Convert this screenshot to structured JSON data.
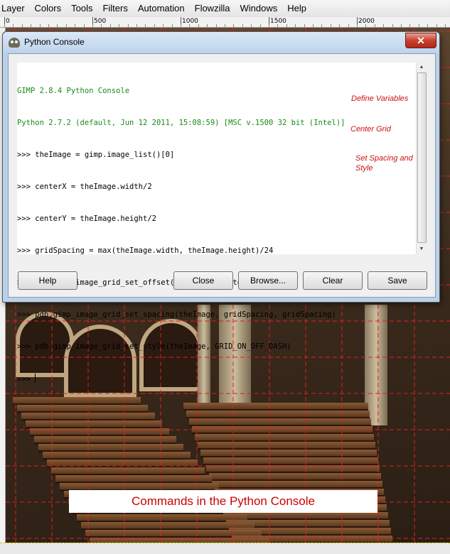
{
  "menubar": {
    "items": [
      {
        "label": "Layer"
      },
      {
        "label": "Colors"
      },
      {
        "label": "Tools"
      },
      {
        "label": "Filters"
      },
      {
        "label": "Automation"
      },
      {
        "label": "Flowzilla"
      },
      {
        "label": "Windows"
      },
      {
        "label": "Help"
      }
    ]
  },
  "ruler": {
    "labels": [
      "0",
      "500",
      "1000",
      "1500",
      "2000"
    ]
  },
  "dialog": {
    "title": "Python Console",
    "close_glyph": "✕",
    "console_lines": [
      {
        "text": "GIMP 2.8.4 Python Console",
        "color": "green"
      },
      {
        "text": "Python 2.7.2 (default, Jun 12 2011, 15:08:59) [MSC v.1500 32 bit (Intel)]",
        "color": "green"
      },
      {
        "text": ">>> theImage = gimp.image_list()[0]",
        "color": "black"
      },
      {
        "text": ">>> centerX = theImage.width/2",
        "color": "black"
      },
      {
        "text": ">>> centerY = theImage.height/2",
        "color": "black"
      },
      {
        "text": ">>> gridSpacing = max(theImage.width, theImage.height)/24",
        "color": "black"
      },
      {
        "text": ">>> pdb.gimp_image_grid_set_offset(theImage, centerX, centerY)",
        "color": "black"
      },
      {
        "text": ">>> pdb.gimp_image_grid_set_spacing(theImage, gridSpacing, gridSpacing)",
        "color": "black"
      },
      {
        "text": ">>> pdb.gimp_image_grid_set_style(theImage, GRID_ON_OFF_DASH)",
        "color": "black"
      },
      {
        "text": ">>> ",
        "color": "black"
      }
    ],
    "annotations": {
      "define": "Define Variables",
      "center": "Center Grid",
      "spacing": "Set Spacing and Style"
    },
    "buttons": {
      "help": "Help",
      "close": "Close",
      "browse": "Browse...",
      "clear": "Clear",
      "save": "Save"
    }
  },
  "caption": "Commands in the Python Console",
  "colors": {
    "prompt_green": "#1a8a1a",
    "annotation_red": "#cc1111",
    "grid_red": "#e02020"
  }
}
